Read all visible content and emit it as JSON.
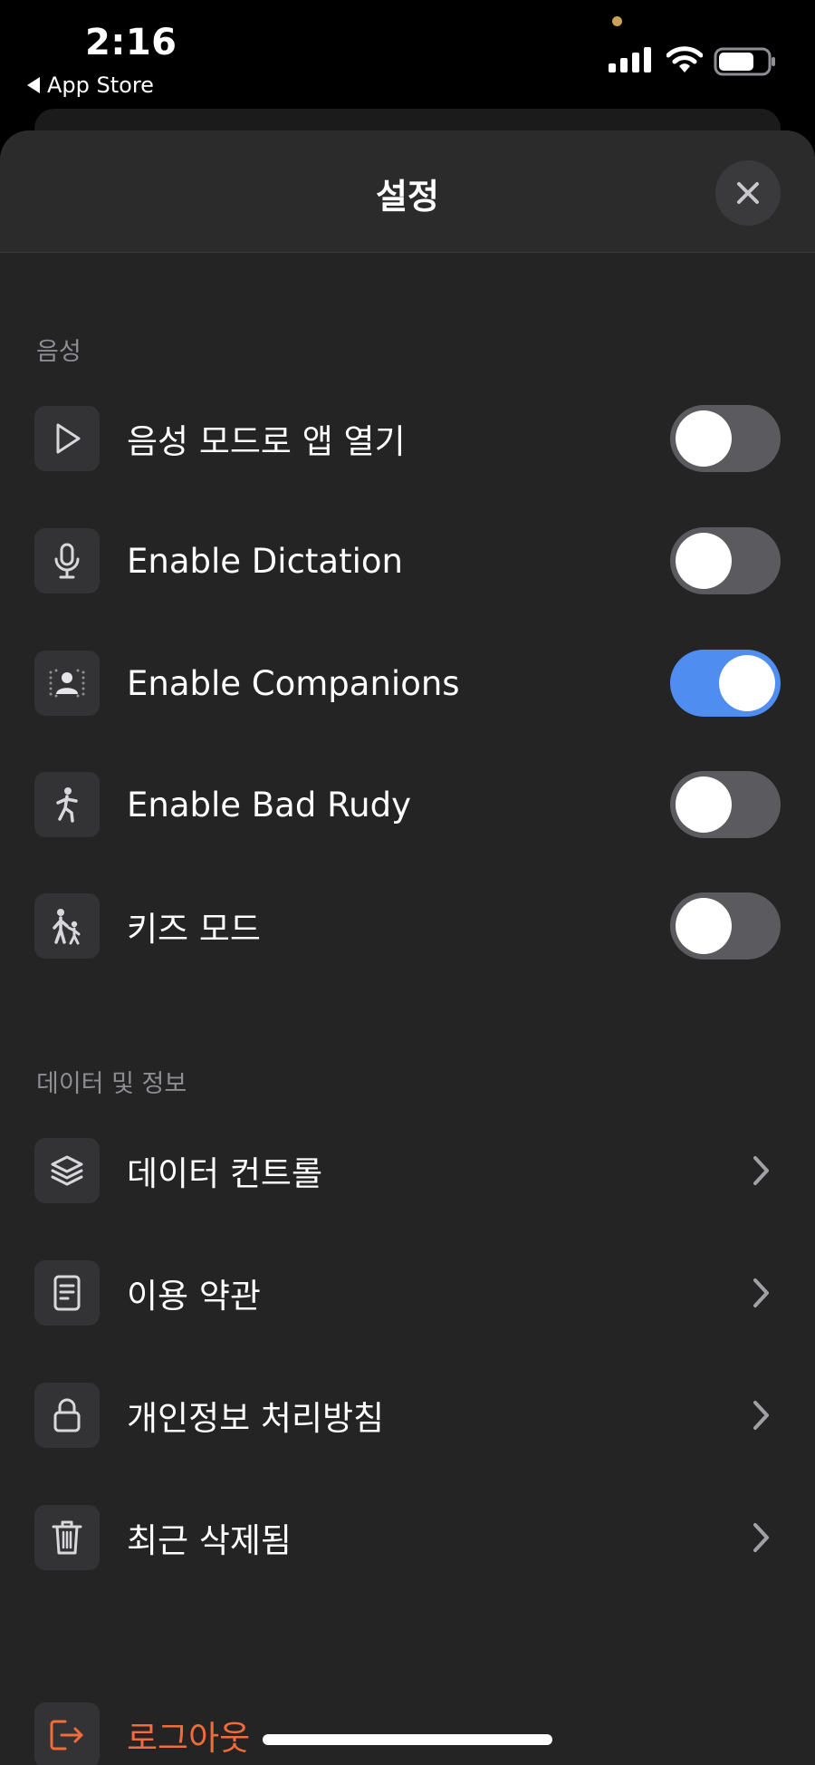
{
  "status_bar": {
    "time": "2:16",
    "back_app": "App Store",
    "indicator_color": "#c9a15a"
  },
  "sheet": {
    "title": "설정",
    "close_icon": "close-icon"
  },
  "voice_section": {
    "label": "음성",
    "items": [
      {
        "label": "음성 모드로 앱 열기",
        "icon": "play-icon",
        "toggle": false
      },
      {
        "label": "Enable Dictation",
        "icon": "microphone-icon",
        "toggle": false
      },
      {
        "label": "Enable Companions",
        "icon": "person-spotlight-icon",
        "toggle": true
      },
      {
        "label": "Enable Bad Rudy",
        "icon": "person-walking-icon",
        "toggle": false
      },
      {
        "label": "키즈 모드",
        "icon": "parent-child-icon",
        "toggle": false
      }
    ]
  },
  "data_section": {
    "label": "데이터 및 정보",
    "items": [
      {
        "label": "데이터 컨트롤",
        "icon": "layers-icon"
      },
      {
        "label": "이용 약관",
        "icon": "document-icon"
      },
      {
        "label": "개인정보 처리방침",
        "icon": "lock-icon"
      },
      {
        "label": "최근 삭제됨",
        "icon": "trash-icon"
      }
    ]
  },
  "logout": {
    "label": "로그아웃",
    "icon": "logout-icon",
    "color": "#f26b3a"
  },
  "colors": {
    "toggle_on": "#4f8ef0",
    "toggle_off": "#5b5b5f",
    "sheet_bg": "#242425"
  }
}
